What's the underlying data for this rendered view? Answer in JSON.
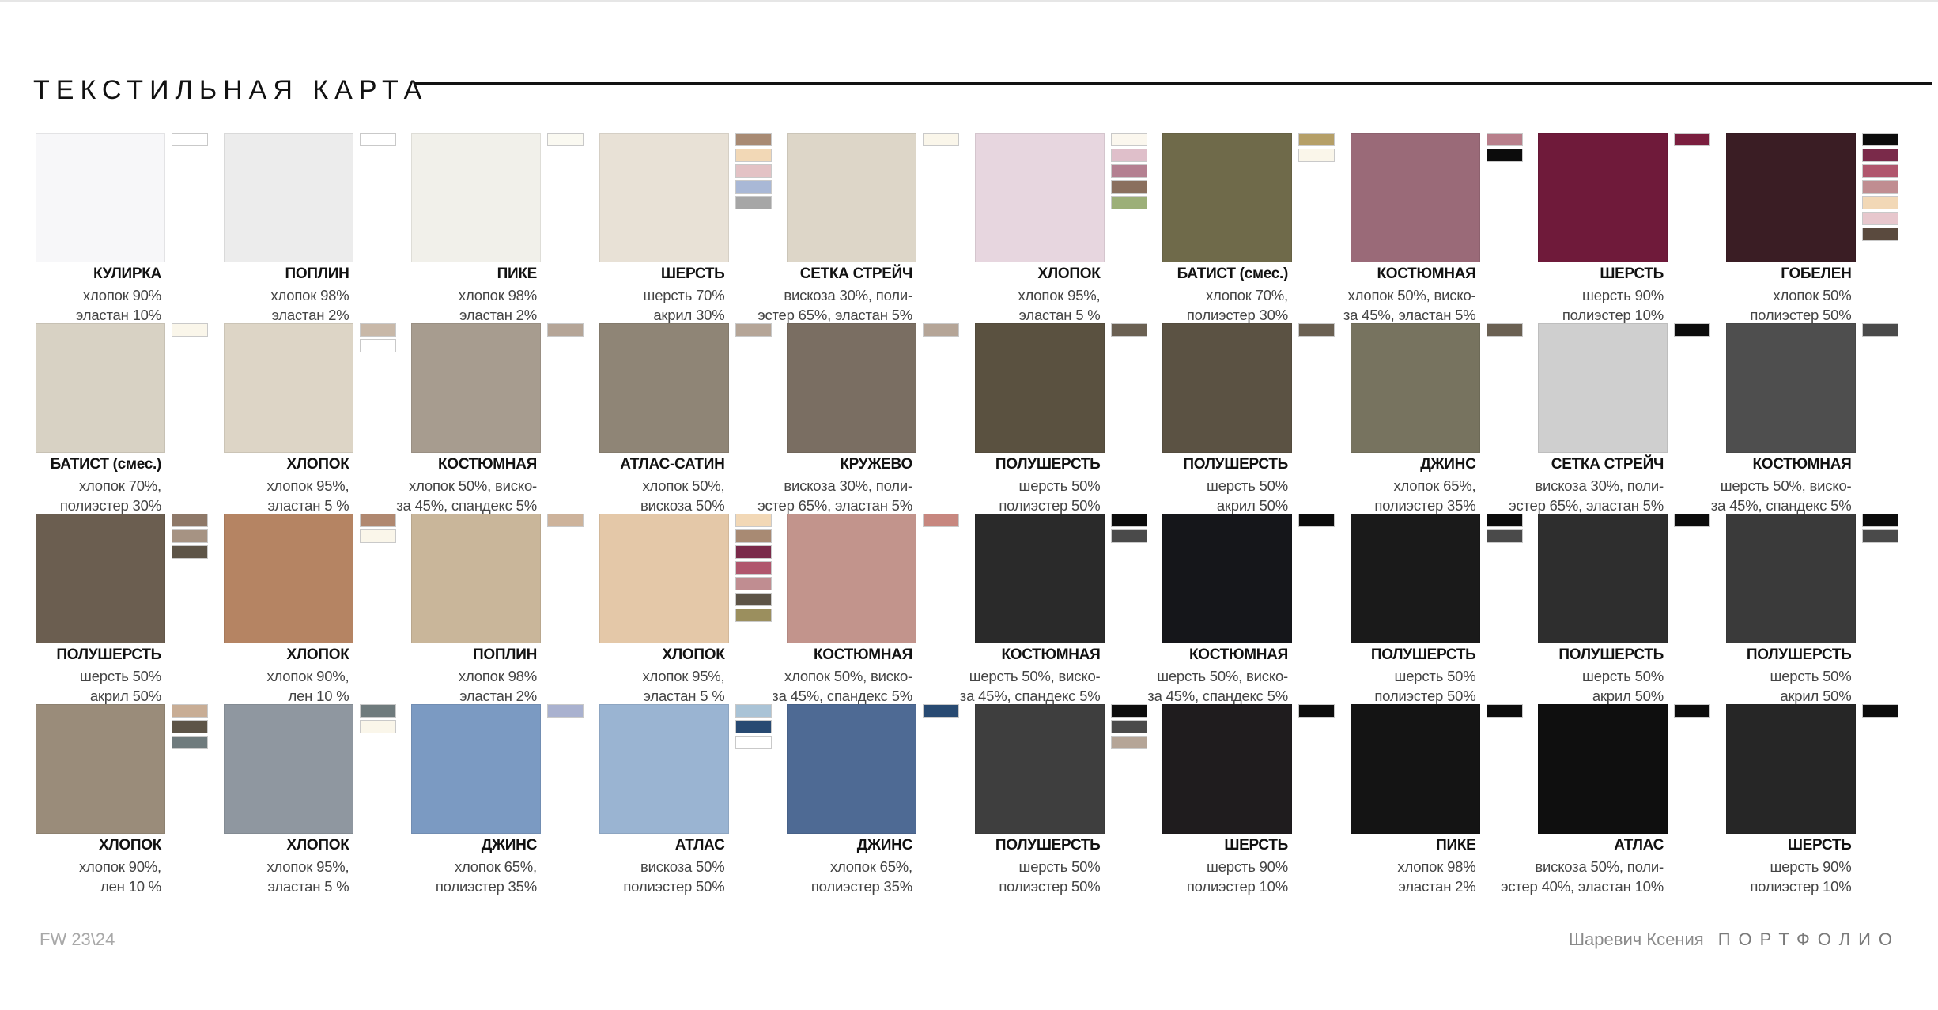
{
  "header": {
    "title": "ТЕКСТИЛЬНАЯ КАРТА"
  },
  "footer": {
    "season": "FW 23\\24",
    "author": "Шаревич Ксения",
    "section": "ПОРТФОЛИО"
  },
  "fabrics": [
    [
      {
        "name": "КУЛИРКА",
        "composition": [
          "хлопок 90%",
          "эластан 10%"
        ],
        "texture": "#f7f7f9",
        "chips": [
          "#ffffff"
        ]
      },
      {
        "name": "ПОПЛИН",
        "composition": [
          "хлопок 98%",
          "эластан 2%"
        ],
        "texture": "#ececec",
        "chips": [
          "#ffffff"
        ]
      },
      {
        "name": "ПИКЕ",
        "composition": [
          "хлопок 98%",
          "эластан 2%"
        ],
        "texture": "#f1f0ea",
        "chips": [
          "#faf9f1"
        ]
      },
      {
        "name": "ШЕРСТЬ",
        "composition": [
          "шерсть 70%",
          "акрил 30%"
        ],
        "texture": "#e8e1d6",
        "chips": [
          "#a88a73",
          "#f2d8b6",
          "#e3c2c5",
          "#a9b8d6",
          "#a6a6a6"
        ]
      },
      {
        "name": "СЕТКА СТРЕЙЧ",
        "composition": [
          "вискоза 30%, поли-",
          "эстер 65%, эластан 5%"
        ],
        "texture": "#ddd6c8",
        "chips": [
          "#faf6ea"
        ]
      },
      {
        "name": "ХЛОПОК",
        "composition": [
          "хлопок 95%,",
          "эластан 5 %"
        ],
        "texture": "#e7d6df",
        "chips": [
          "#fbf7ee",
          "#dfbfca",
          "#b48091",
          "#8a6f5e",
          "#9caf78"
        ]
      },
      {
        "name": "БАТИСТ (смес.)",
        "composition": [
          "хлопок 70%,",
          "полиэстер 30%"
        ],
        "texture": "#6f6a4a",
        "chips": [
          "#b59f67",
          "#faf6ea"
        ]
      },
      {
        "name": "КОСТЮМНАЯ",
        "composition": [
          "хлопок 50%, виско-",
          "за 45%, эластан 5%"
        ],
        "texture": "#9a6a78",
        "chips": [
          "#b87f8b",
          "#0c0c0c"
        ]
      },
      {
        "name": "ШЕРСТЬ",
        "composition": [
          "шерсть 90%",
          "полиэстер 10%"
        ],
        "texture": "#6f1a3a",
        "chips": [
          "#7a1e3e"
        ]
      },
      {
        "name": "ГОБЕЛЕН",
        "composition": [
          "хлопок 50%",
          "полиэстер 50%"
        ],
        "texture": "#3a1d24",
        "chips": [
          "#0c0c0c",
          "#7a2a4a",
          "#b0566d",
          "#c08d91",
          "#f2d8b6",
          "#e7c7cd",
          "#5a4a3e"
        ]
      }
    ],
    [
      {
        "name": "БАТИСТ (смес.)",
        "composition": [
          "хлопок 70%,",
          "полиэстер 30%"
        ],
        "texture": "#d8d2c4",
        "chips": [
          "#faf6ea"
        ]
      },
      {
        "name": "ХЛОПОК",
        "composition": [
          "хлопок 95%,",
          "эластан 5 %"
        ],
        "texture": "#ddd5c6",
        "chips": [
          "#c8b8a8",
          "#ffffff"
        ]
      },
      {
        "name": "КОСТЮМНАЯ",
        "composition": [
          "хлопок 50%, виско-",
          "за 45%, спандекс 5%"
        ],
        "texture": "#a79c8f",
        "chips": [
          "#b5a597"
        ]
      },
      {
        "name": "АТЛАС-САТИН",
        "composition": [
          "хлопок 50%,",
          "вискоза 50%"
        ],
        "texture": "#8f8576",
        "chips": [
          "#b5a597"
        ]
      },
      {
        "name": "КРУЖЕВО",
        "composition": [
          "вискоза 30%, поли-",
          "эстер 65%, эластан 5%"
        ],
        "texture": "#7a6e62",
        "chips": [
          "#b5a597"
        ]
      },
      {
        "name": "ПОЛУШЕРСТЬ",
        "composition": [
          "шерсть 50%",
          "полиэстер 50%"
        ],
        "texture": "#5a5140",
        "chips": [
          "#6a6052"
        ]
      },
      {
        "name": "ПОЛУШЕРСТЬ",
        "composition": [
          "шерсть 50%",
          "акрил 50%"
        ],
        "texture": "#5b5243",
        "chips": [
          "#6a6052"
        ]
      },
      {
        "name": "ДЖИНС",
        "composition": [
          "хлопок 65%,",
          "полиэстер 35%"
        ],
        "texture": "#77735f",
        "chips": [
          "#6a6052"
        ]
      },
      {
        "name": "СЕТКА СТРЕЙЧ",
        "composition": [
          "вискоза 30%, поли-",
          "эстер 65%, эластан 5%"
        ],
        "texture": "#cfcfcf",
        "chips": [
          "#0c0c0c"
        ]
      },
      {
        "name": "КОСТЮМНАЯ",
        "composition": [
          "шерсть 50%, виско-",
          "за 45%, спандекс 5%"
        ],
        "texture": "#4e4e4e",
        "chips": [
          "#4a4a4a"
        ]
      }
    ],
    [
      {
        "name": "ПОЛУШЕРСТЬ",
        "composition": [
          "шерсть 50%",
          "акрил 50%"
        ],
        "texture": "#6b5e50",
        "chips": [
          "#8e7868",
          "#a69383",
          "#5d5447"
        ]
      },
      {
        "name": "ХЛОПОК",
        "composition": [
          "хлопок 90%,",
          "лен 10 %"
        ],
        "texture": "#b58463",
        "chips": [
          "#b08870",
          "#faf6ea"
        ]
      },
      {
        "name": "ПОПЛИН",
        "composition": [
          "хлопок 98%",
          "эластан 2%"
        ],
        "texture": "#c9b69a",
        "chips": [
          "#cdb39b"
        ]
      },
      {
        "name": "ХЛОПОК",
        "composition": [
          "хлопок 95%,",
          "эластан 5 %"
        ],
        "texture": "#e4c8a8",
        "chips": [
          "#f2d8b6",
          "#a88a73",
          "#7a2a4a",
          "#b0566d",
          "#c08d91",
          "#5d5447",
          "#9b8f5e"
        ]
      },
      {
        "name": "КОСТЮМНАЯ",
        "composition": [
          "хлопок 50%, виско-",
          "за 45%, спандекс 5%"
        ],
        "texture": "#c2948c",
        "chips": [
          "#c7877f"
        ]
      },
      {
        "name": "КОСТЮМНАЯ",
        "composition": [
          "шерсть 50%, виско-",
          "за 45%, спандекс 5%"
        ],
        "texture": "#2a2a2a",
        "chips": [
          "#0c0c0c",
          "#4a4a4a"
        ]
      },
      {
        "name": "КОСТЮМНАЯ",
        "composition": [
          "шерсть 50%, виско-",
          "за 45%, спандекс 5%"
        ],
        "texture": "#15161a",
        "chips": [
          "#0c0c0c"
        ]
      },
      {
        "name": "ПОЛУШЕРСТЬ",
        "composition": [
          "шерсть 50%",
          "полиэстер 50%"
        ],
        "texture": "#1a1a1a",
        "chips": [
          "#0c0c0c",
          "#4a4a4a"
        ]
      },
      {
        "name": "ПОЛУШЕРСТЬ",
        "composition": [
          "шерсть 50%",
          "акрил 50%"
        ],
        "texture": "#2e2e2e",
        "chips": [
          "#0c0c0c"
        ]
      },
      {
        "name": "ПОЛУШЕРСТЬ",
        "composition": [
          "шерсть 50%",
          "акрил 50%"
        ],
        "texture": "#3a3a3a",
        "chips": [
          "#0c0c0c",
          "#4a4a4a"
        ]
      }
    ],
    [
      {
        "name": "ХЛОПОК",
        "composition": [
          "хлопок 90%,",
          "лен 10 %"
        ],
        "texture": "#9a8c7a",
        "chips": [
          "#c8ad95",
          "#5d5447",
          "#6f7b7d"
        ]
      },
      {
        "name": "ХЛОПОК",
        "composition": [
          "хлопок 95%,",
          "эластан 5 %"
        ],
        "texture": "#8f97a0",
        "chips": [
          "#6f7b7d",
          "#faf6ea"
        ]
      },
      {
        "name": "ДЖИНС",
        "composition": [
          "хлопок 65%,",
          "полиэстер 35%"
        ],
        "texture": "#7b9ac2",
        "chips": [
          "#a9b1cf"
        ]
      },
      {
        "name": "АТЛАС",
        "composition": [
          "вискоза 50%",
          "полиэстер 50%"
        ],
        "texture": "#9ab4d2",
        "chips": [
          "#a9c3d6",
          "#284a72",
          "#ffffff"
        ]
      },
      {
        "name": "ДЖИНС",
        "composition": [
          "хлопок 65%,",
          "полиэстер 35%"
        ],
        "texture": "#4e6a94",
        "chips": [
          "#284a72"
        ]
      },
      {
        "name": "ПОЛУШЕРСТЬ",
        "composition": [
          "шерсть 50%",
          "полиэстер 50%"
        ],
        "texture": "#3e3e3e",
        "chips": [
          "#0c0c0c",
          "#4a4a4a",
          "#b5a597"
        ]
      },
      {
        "name": "ШЕРСТЬ",
        "composition": [
          "шерсть 90%",
          "полиэстер 10%"
        ],
        "texture": "#1f1c1e",
        "chips": [
          "#0c0c0c"
        ]
      },
      {
        "name": "ПИКЕ",
        "composition": [
          "хлопок 98%",
          "эластан 2%"
        ],
        "texture": "#141414",
        "chips": [
          "#0c0c0c"
        ]
      },
      {
        "name": "АТЛАС",
        "composition": [
          "вискоза 50%, поли-",
          "эстер 40%, эластан 10%"
        ],
        "texture": "#0f0f0f",
        "chips": [
          "#0c0c0c"
        ]
      },
      {
        "name": "ШЕРСТЬ",
        "composition": [
          "шерсть 90%",
          "полиэстер 10%"
        ],
        "texture": "#262626",
        "chips": [
          "#0c0c0c"
        ]
      }
    ]
  ]
}
